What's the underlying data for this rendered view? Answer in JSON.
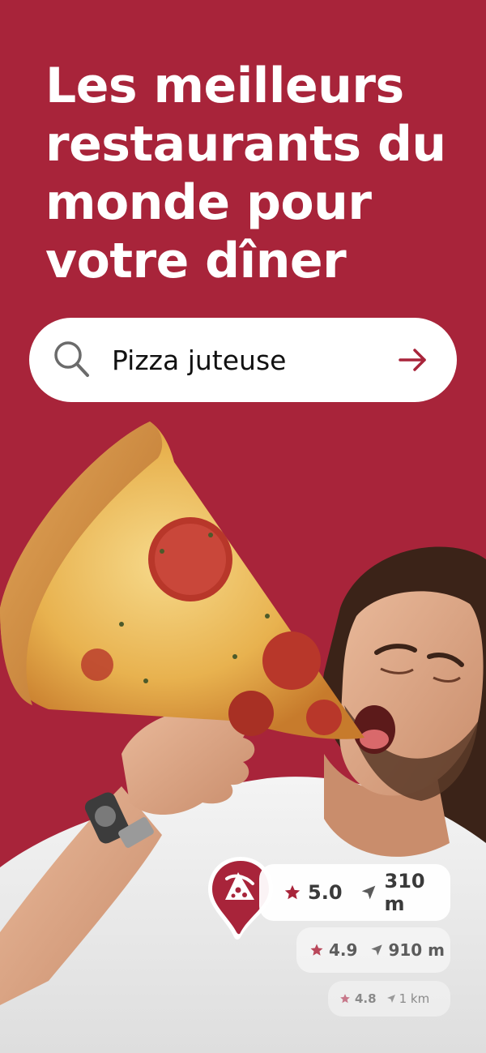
{
  "hero": {
    "line1": "Les meilleurs",
    "line2": "restaurants du",
    "line3": "monde pour",
    "line4": "votre dîner"
  },
  "search": {
    "value": "Pizza juteuse",
    "icon": "search-icon",
    "submit_icon": "arrow-right-icon"
  },
  "results": [
    {
      "rating": "5.0",
      "distance": "310 m"
    },
    {
      "rating": "4.9",
      "distance": "910 m"
    },
    {
      "rating": "4.8",
      "distance": "1 km"
    }
  ],
  "colors": {
    "brand": "#a8243a",
    "text_on_brand": "#ffffff",
    "search_bg": "#ffffff"
  }
}
